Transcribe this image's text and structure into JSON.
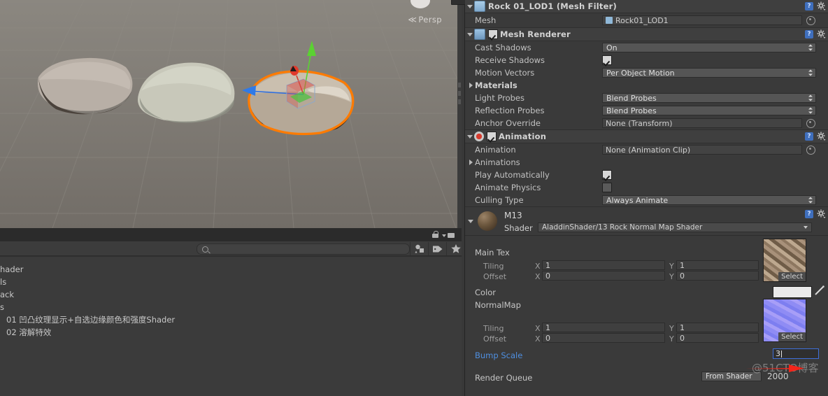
{
  "scene": {
    "view_label": "Persp",
    "gizmo_name": "view-gizmo",
    "rocks": [
      "rock-left",
      "rock-middle",
      "rock-selected"
    ]
  },
  "project": {
    "search_placeholder": "",
    "toolbar_icons": [
      "filter-by-type-icon",
      "filter-by-label-icon",
      "favorite-star-icon"
    ],
    "lock_icon": "lock-icon",
    "menu_icon": "panel-menu-icon",
    "items": [
      {
        "label": "hader"
      },
      {
        "label": "ls"
      },
      {
        "label": "ack"
      },
      {
        "label": "s"
      },
      {
        "label": "01 凹凸纹理显示+自选边缘颜色和强度Shader"
      },
      {
        "label": "02 溶解特效"
      }
    ]
  },
  "inspector": {
    "components": [
      {
        "title": "Rock 01_LOD1 (Mesh Filter)",
        "icon": "mesh-filter-icon",
        "has_enable_checkbox": false,
        "help_label": "?",
        "rows": [
          {
            "label": "Mesh",
            "type": "objectfield",
            "value": "Rock01_LOD1"
          }
        ]
      },
      {
        "title": "Mesh Renderer",
        "icon": "mesh-renderer-icon",
        "has_enable_checkbox": true,
        "enabled": true,
        "help_label": "?",
        "rows": [
          {
            "label": "Cast Shadows",
            "type": "popup",
            "value": "On"
          },
          {
            "label": "Receive Shadows",
            "type": "checkbox",
            "checked": true
          },
          {
            "label": "Motion Vectors",
            "type": "popup",
            "value": "Per Object Motion"
          },
          {
            "label": "Materials",
            "type": "foldout"
          },
          {
            "label": "Light Probes",
            "type": "popup",
            "value": "Blend Probes"
          },
          {
            "label": "Reflection Probes",
            "type": "popup",
            "value": "Blend Probes"
          },
          {
            "label": "Anchor Override",
            "type": "objectfield",
            "value": "None (Transform)"
          }
        ]
      },
      {
        "title": "Animation",
        "icon": "animation-icon",
        "has_enable_checkbox": true,
        "enabled": true,
        "help_label": "?",
        "rows": [
          {
            "label": "Animation",
            "type": "objectfield",
            "value": "None (Animation Clip)"
          },
          {
            "label": "Animations",
            "type": "foldout"
          },
          {
            "label": "Play Automatically",
            "type": "checkbox",
            "checked": true
          },
          {
            "label": "Animate Physics",
            "type": "checkbox",
            "checked": false
          },
          {
            "label": "Culling Type",
            "type": "popup",
            "value": "Always Animate"
          }
        ]
      }
    ],
    "material": {
      "name": "M13",
      "shader_label": "Shader",
      "shader_value": "AladdinShader/13 Rock Normal Map Shader",
      "help_label": "?",
      "properties": {
        "main_tex_label": "Main Tex",
        "main_tex_tiling_label": "Tiling",
        "main_tex_offset_label": "Offset",
        "main_tex_tiling_x_axis": "X",
        "main_tex_tiling_x": "1",
        "main_tex_tiling_y_axis": "Y",
        "main_tex_tiling_y": "1",
        "main_tex_offset_x_axis": "X",
        "main_tex_offset_x": "0",
        "main_tex_offset_y_axis": "Y",
        "main_tex_offset_y": "0",
        "main_tex_select": "Select",
        "color_label": "Color",
        "color_value": "#EAEAEA",
        "normalmap_label": "NormalMap",
        "normal_tiling_label": "Tiling",
        "normal_offset_label": "Offset",
        "normal_tiling_x_axis": "X",
        "normal_tiling_x": "1",
        "normal_tiling_y_axis": "Y",
        "normal_tiling_y": "1",
        "normal_offset_x_axis": "X",
        "normal_offset_x": "0",
        "normal_offset_y_axis": "Y",
        "normal_offset_y": "0",
        "normal_select": "Select",
        "bump_scale_label": "Bump Scale",
        "bump_scale_value": "3",
        "render_queue_label": "Render Queue",
        "render_queue_source": "From Shader",
        "render_queue_value": "2000"
      }
    }
  },
  "watermark": "@51CTO博客",
  "colors": {
    "accent_blue": "#3f6fd8",
    "link_blue": "#4f8fe0",
    "selection_orange": "#ff7b00",
    "panel_bg": "#3a3a3a",
    "scene_bg": "#7c7771"
  }
}
